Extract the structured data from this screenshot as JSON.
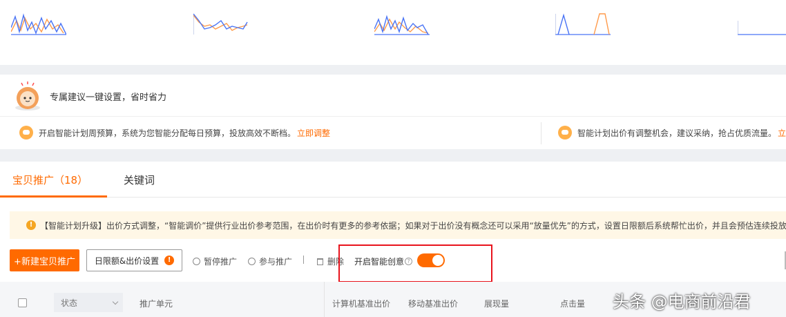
{
  "colors": {
    "accent": "#ff6a00",
    "blue_line": "#4a74f5",
    "orange_line": "#ff9a4a",
    "highlight_box": "#e8131c",
    "notice_bg": "#fff7e6"
  },
  "suggest": {
    "title": "专属建议一键设置，省时省力",
    "cards": [
      {
        "text": "开启智能计划周预算，系统为您智能分配每日预算，投放高效不断档。",
        "link": "立即调整"
      },
      {
        "text": "智能计划出价有调整机会，建议采纳，抢占优质流量。",
        "link": "立"
      }
    ]
  },
  "tabs": [
    {
      "label": "宝贝推广（18）",
      "active": true
    },
    {
      "label": "关键词",
      "active": false
    }
  ],
  "notice": {
    "text": "【智能计划升级】出价方式调整，“智能调价”提供行业出价参考范围，在出价时有更多的参考依据；如果对于出价没有概念还可以采用“放量优先”的方式，设置日限额后系统帮忙出价，并且会预估连续投放可"
  },
  "toolbar": {
    "new_label": "+新建宝贝推广",
    "budget_label": "日限额&出价设置",
    "budget_badge": "!",
    "pause_label": "暂停推广",
    "join_label": "参与推广",
    "delete_label": "删除",
    "smart_label": "开启智能创意",
    "smart_on": true
  },
  "table_header": {
    "status_placeholder": "状态",
    "columns": [
      "推广单元",
      "计算机基准出价",
      "移动基准出价",
      "展现量",
      "点击量"
    ]
  },
  "watermark": "头条 @电商前沿君"
}
